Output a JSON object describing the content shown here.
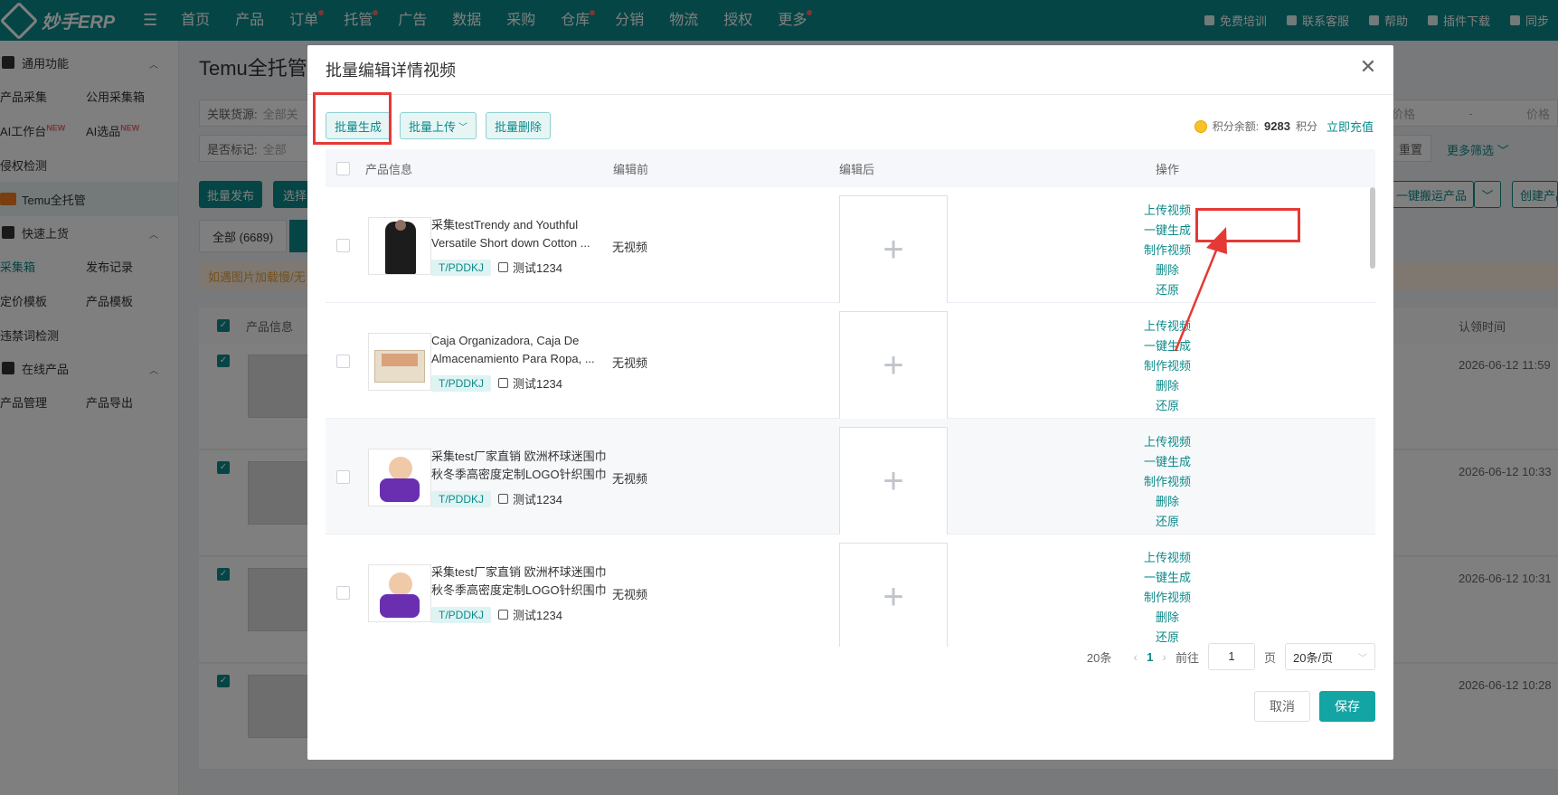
{
  "app": {
    "logo_text": "妙手ERP"
  },
  "nav": {
    "items": [
      {
        "label": "首页",
        "dot": false
      },
      {
        "label": "产品",
        "dot": false
      },
      {
        "label": "订单",
        "dot": true
      },
      {
        "label": "托管",
        "dot": true
      },
      {
        "label": "广告",
        "dot": false
      },
      {
        "label": "数据",
        "dot": false
      },
      {
        "label": "采购",
        "dot": false
      },
      {
        "label": "仓库",
        "dot": true
      },
      {
        "label": "分销",
        "dot": false
      },
      {
        "label": "物流",
        "dot": false
      },
      {
        "label": "授权",
        "dot": false
      },
      {
        "label": "更多",
        "dot": true
      }
    ],
    "right": [
      "免费培训",
      "联系客服",
      "帮助",
      "插件下载",
      "同步"
    ]
  },
  "sidebar": {
    "group1": "通用功能",
    "row1": [
      "产品采集",
      "公用采集箱"
    ],
    "row2": [
      "AI工作台",
      "AI选品"
    ],
    "new_badge": "NEW",
    "row3": "侵权检测",
    "temu": "Temu全托管",
    "group2": "快速上货",
    "row4": [
      "采集箱",
      "发布记录"
    ],
    "row5": [
      "定价模板",
      "产品模板"
    ],
    "row6": "违禁词检测",
    "group3": "在线产品",
    "row7": [
      "产品管理",
      "产品导出"
    ]
  },
  "background": {
    "title": "Temu全托管",
    "filter1_label": "关联货源:",
    "filter1_value": "全部关",
    "filter2_label": "是否标记:",
    "filter2_value": "全部",
    "price_placeholder": "价格",
    "price_placeholder2": "价格",
    "reset": "重置",
    "more_filter": "更多筛选",
    "btn_publish": "批量发布",
    "btn_select": "选择",
    "btn_onekey": "一键搬运产品",
    "btn_create": "创建产品",
    "tab_all": "全部 (6689)",
    "notice": "如遇图片加载慢/无",
    "col_product": "产品信息",
    "col_time": "认领时间",
    "times": [
      "2026-06-12 11:59",
      "2026-06-12 10:33",
      "2026-06-12 10:31",
      "2026-06-12 10:28"
    ]
  },
  "modal": {
    "title": "批量编辑详情视频",
    "btn_generate": "批量生成",
    "btn_upload": "批量上传",
    "btn_delete": "批量删除",
    "points_label": "积分余额:",
    "points_value": "9283",
    "points_unit": "积分",
    "recharge": "立即充值",
    "columns": {
      "product": "产品信息",
      "before": "编辑前",
      "after": "编辑后",
      "ops": "操作"
    },
    "rows": [
      {
        "title": "采集testTrendy and Youthful Versatile Short down Cotton ...",
        "tag": "T/PDDKJ",
        "store": "测试1234",
        "before": "无视频",
        "ops": [
          "上传视频",
          "一键生成",
          "制作视频",
          "删除",
          "还原"
        ]
      },
      {
        "title": "Caja Organizadora, Caja De Almacenamiento Para Ropa, ...",
        "tag": "T/PDDKJ",
        "store": "测试1234",
        "before": "无视频",
        "ops": [
          "上传视频",
          "一键生成",
          "制作视频",
          "删除",
          "还原"
        ]
      },
      {
        "title": "采集test厂家直销 欧洲杯球迷围巾秋冬季高密度定制LOGO针织围巾",
        "tag": "T/PDDKJ",
        "store": "测试1234",
        "before": "无视频",
        "ops": [
          "上传视频",
          "一键生成",
          "制作视频",
          "删除",
          "还原"
        ]
      },
      {
        "title": "采集test厂家直销 欧洲杯球迷围巾秋冬季高密度定制LOGO针织围巾",
        "tag": "T/PDDKJ",
        "store": "测试1234",
        "before": "无视频",
        "ops": [
          "上传视频",
          "一键生成",
          "制作视频",
          "删除",
          "还原"
        ]
      }
    ],
    "pager": {
      "total": "20条",
      "current": "1",
      "goto": "前往",
      "goto_value": "1",
      "page_unit": "页",
      "page_size": "20条/页"
    },
    "cancel": "取消",
    "save": "保存"
  },
  "colors": {
    "brand": "#0d8a8a",
    "highlight": "#e53935"
  }
}
